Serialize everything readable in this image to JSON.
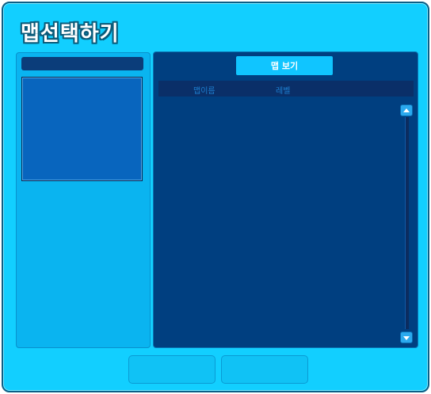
{
  "window": {
    "title": "맵선택하기"
  },
  "right_panel": {
    "view_button_label": "맵 보기",
    "list": {
      "columns": [
        "맵이름",
        "레벨"
      ],
      "rows": []
    }
  },
  "bottom_buttons": {
    "left_label": "",
    "right_label": ""
  },
  "icons": {
    "scroll_up": "triangle-up-icon",
    "scroll_down": "triangle-down-icon"
  },
  "colors": {
    "window_bg": "#12cfff",
    "panel_dark": "#003f80",
    "accent_button": "#10c5ff"
  }
}
